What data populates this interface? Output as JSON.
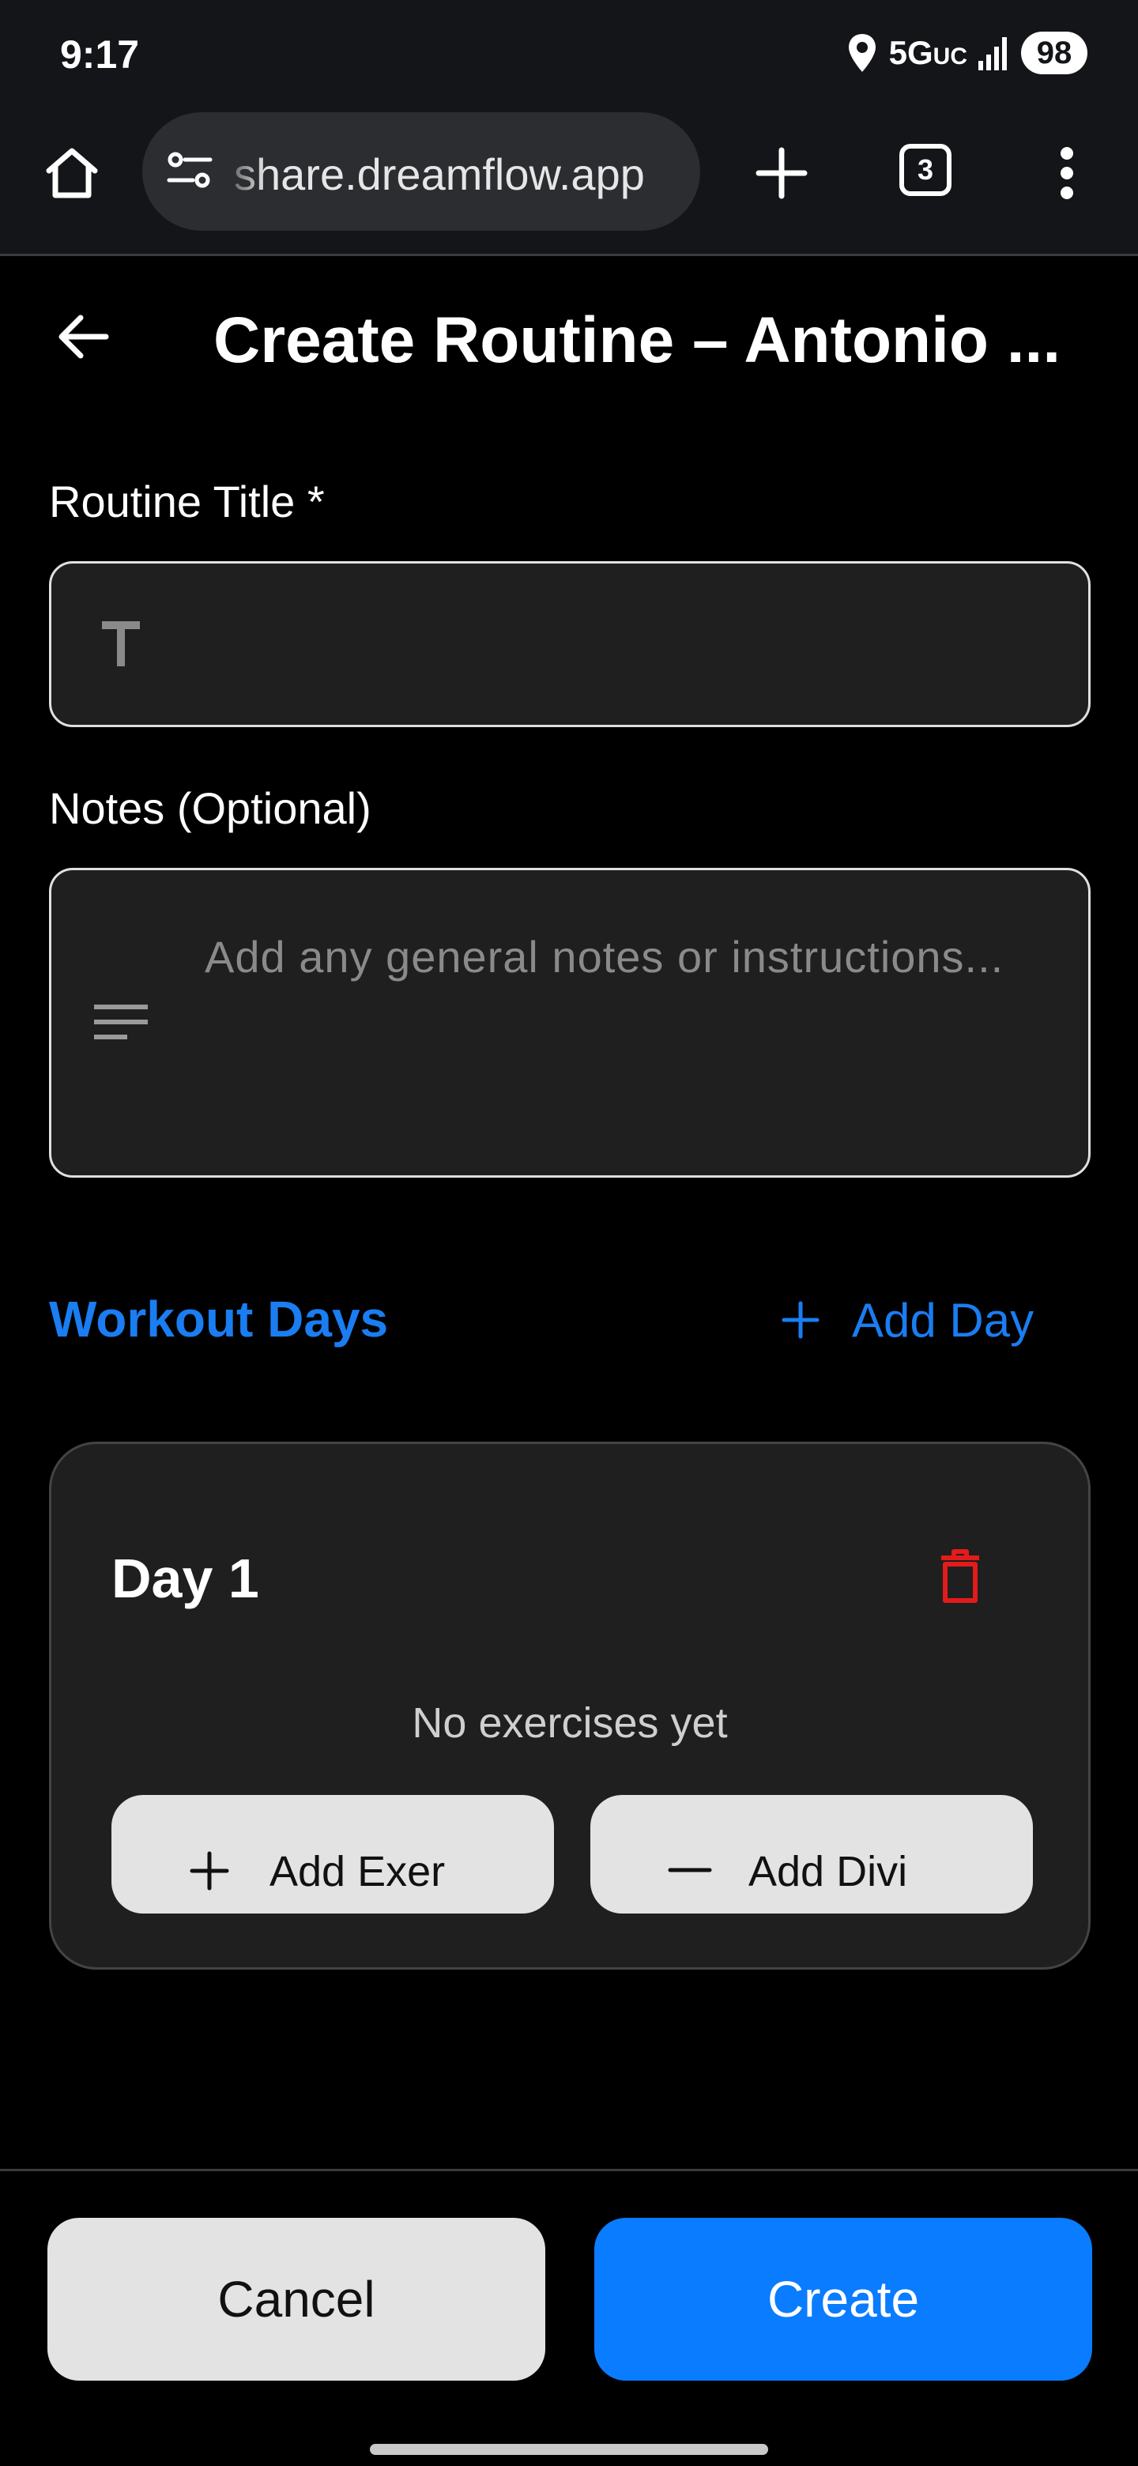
{
  "status_bar": {
    "time": "9:17",
    "network": "5G",
    "network_suffix": "UC",
    "battery": "98"
  },
  "browser": {
    "url": "share.dreamflow.app",
    "tab_count": "3"
  },
  "header": {
    "title": "Create Routine – Antonio ..."
  },
  "form": {
    "title_label": "Routine Title *",
    "title_value": "",
    "notes_label": "Notes (Optional)",
    "notes_placeholder": "Add any general notes or instructions..."
  },
  "workout_days": {
    "section_title": "Workout Days",
    "add_day_label": "Add Day",
    "days": [
      {
        "title": "Day 1",
        "empty_text": "No exercises yet",
        "add_exercise_label": "Add Exer",
        "add_divider_label": "Add Divi"
      }
    ]
  },
  "footer": {
    "cancel_label": "Cancel",
    "create_label": "Create"
  },
  "colors": {
    "accent": "#0A7CFF",
    "danger": "#E21B1B",
    "card": "#1F1F1F"
  }
}
